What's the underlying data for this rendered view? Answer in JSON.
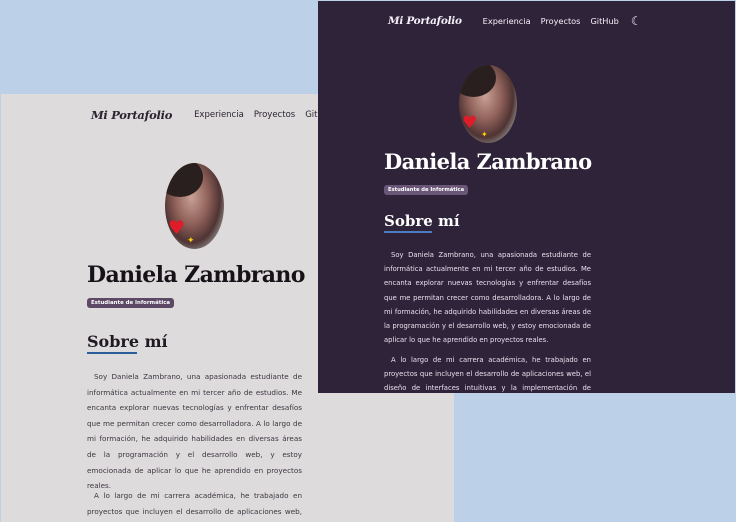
{
  "light": {
    "logo": "Mi Portafolio",
    "nav": [
      "Experiencia",
      "Proyectos",
      "GitHub"
    ],
    "theme_icon": "sun-icon",
    "name": "Daniela Zambrano",
    "badge": "Estudiante de Informática",
    "section_title": "Sobre mí",
    "paragraphs": [
      "Soy Daniela Zambrano, una apasionada estudiante de informática actualmente en mi tercer año de estudios. Me encanta explorar nuevas tecnologías y enfrentar desafíos que me permitan crecer como desarrolladora. A lo largo de mi formación, he adquirido habilidades en diversas áreas de la programación y el desarrollo web, y estoy emocionada de aplicar lo que he aprendido en proyectos reales.",
      "A lo largo de mi carrera académica, he trabajado en proyectos que incluyen el desarrollo de aplicaciones web, el diseño de inter-"
    ]
  },
  "dark": {
    "logo": "Mi Portafolio",
    "nav": [
      "Experiencia",
      "Proyectos",
      "GitHub"
    ],
    "theme_icon": "moon-icon",
    "name": "Daniela Zambrano",
    "badge": "Estudiante de Informática",
    "section_title": "Sobre mí",
    "paragraphs": [
      "Soy Daniela Zambrano, una apasionada estudiante de informática actualmente en mi tercer año de estudios. Me encanta explorar nuevas tecnologías y enfrentar desafíos que me permitan crecer como desarrolladora. A lo largo de mi formación, he adquirido habilidades en diversas áreas de la programación y el desarrollo web, y estoy emocionada de aplicar lo que he aprendido en proyectos reales.",
      "A lo largo de mi carrera académica, he trabajado en proyectos que incluyen el desarrollo de aplicaciones web, el diseño de interfaces intuitivas y la implementación de soluciones tecnológicas inno-"
    ]
  },
  "colors": {
    "page_background": "#bcd1e8",
    "light_background": "#dedbdc",
    "dark_background": "#2f2339",
    "badge_light": "#5d4966",
    "badge_dark": "#6a5778",
    "underline_accent": "#2b5d99"
  }
}
